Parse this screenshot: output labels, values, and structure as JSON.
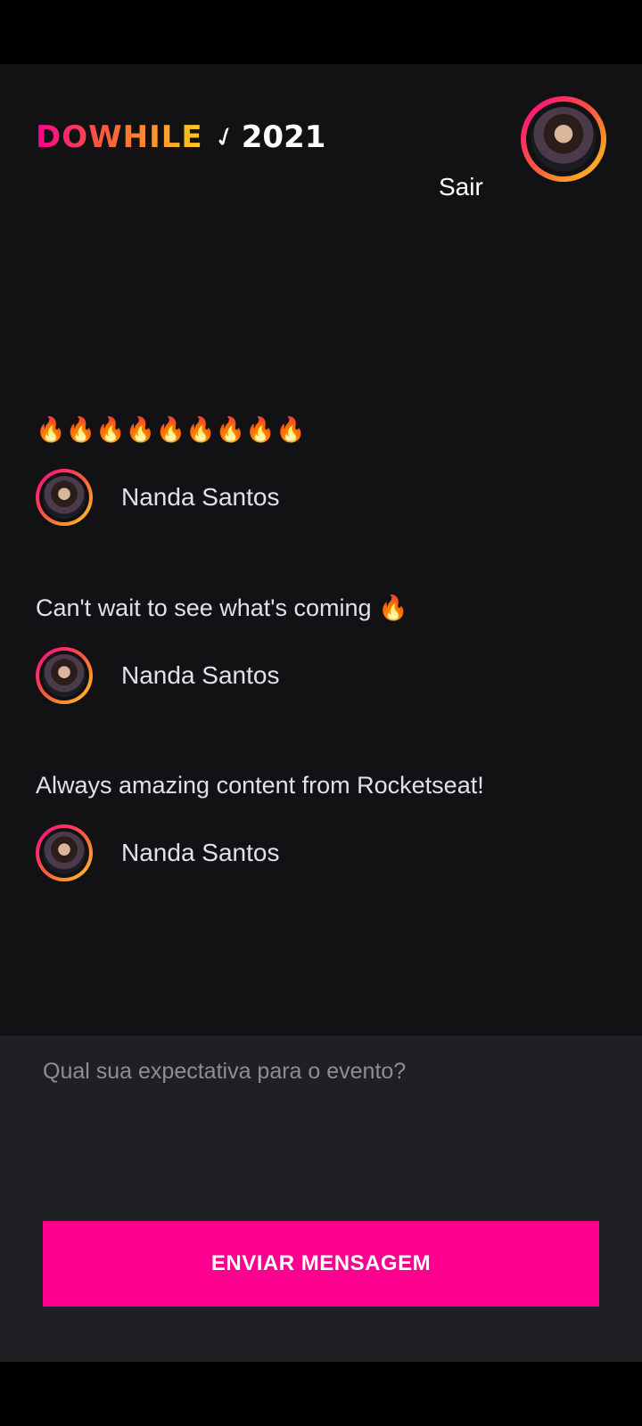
{
  "header": {
    "logo_do": "DOWHILE",
    "logo_mark": "✓",
    "logo_year": "2021",
    "logout_label": "Sair",
    "avatar_icon": "user-avatar"
  },
  "messages": [
    {
      "text": "🔥🔥🔥🔥🔥🔥🔥🔥🔥",
      "user": "Nanda Santos"
    },
    {
      "text": "Can't wait to see what's coming 🔥",
      "user": "Nanda Santos"
    },
    {
      "text": "Always amazing content from Rocketseat!",
      "user": "Nanda Santos"
    }
  ],
  "composer": {
    "placeholder": "Qual sua expectativa para o evento?",
    "send_label": "ENVIAR MENSAGEM"
  },
  "colors": {
    "accent": "#ff008e",
    "gradient_start": "#ff008e",
    "gradient_mid": "#ff5a3c",
    "gradient_end": "#ffcd1e",
    "background": "#121214",
    "composer_bg": "#202024"
  }
}
